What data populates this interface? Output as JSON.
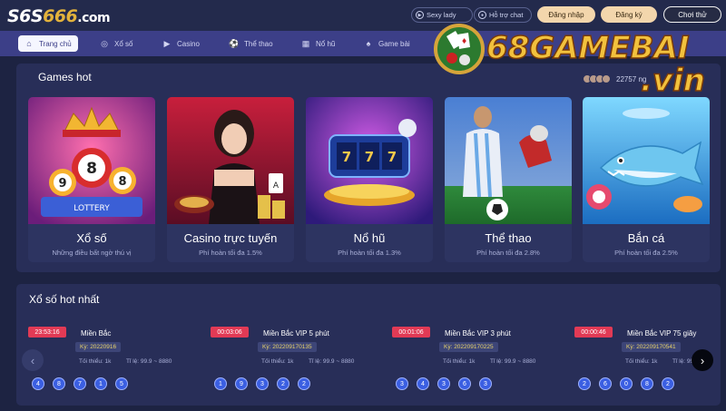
{
  "header": {
    "logo": {
      "left": "S6S",
      "accent": "666",
      "domain": ".com"
    },
    "sexy_lady": "Sexy lady",
    "live_chat": "Hỗ trợ chat",
    "login": "Đăng nhập",
    "register": "Đăng ký",
    "play_trial": "Chơi thử"
  },
  "nav": {
    "items": [
      {
        "label": "Trang chủ",
        "icon": "home-icon"
      },
      {
        "label": "Xổ số",
        "icon": "lottery-icon"
      },
      {
        "label": "Casino",
        "icon": "play-icon"
      },
      {
        "label": "Thể thao",
        "icon": "soccer-icon"
      },
      {
        "label": "Nổ hũ",
        "icon": "slot-icon"
      },
      {
        "label": "Game bài",
        "icon": "cards-icon"
      }
    ]
  },
  "games_hot": {
    "title": "Games hot",
    "online_count": "22757 ng",
    "cards": [
      {
        "title": "Xổ số",
        "sub": "Những điều bất ngờ thú vị",
        "art_label": "LOTTERY"
      },
      {
        "title": "Casino trực tuyến",
        "sub": "Phí hoàn tối đa 1.5%"
      },
      {
        "title": "Nổ hũ",
        "sub": "Phí hoàn tối đa 1.3%"
      },
      {
        "title": "Thể thao",
        "sub": "Phí hoàn tối đa 2.8%"
      },
      {
        "title": "Bắn cá",
        "sub": "Phí hoàn tối đa 2.5%"
      }
    ]
  },
  "lottery_hot": {
    "title": "Xổ số hot nhất",
    "items": [
      {
        "time": "23:53:16",
        "name": "Miền Bắc",
        "ky": "Kỳ: 20220916",
        "min": "Tối thiểu: 1k",
        "rate": "Tỉ lệ: 99.9 ~ 8880",
        "balls": [
          "4",
          "8",
          "7",
          "1",
          "5"
        ]
      },
      {
        "time": "00:03:06",
        "name": "Miền Bắc VIP 5 phút",
        "ky": "Kỳ: 202209170135",
        "min": "Tối thiểu: 1k",
        "rate": "Tỉ lệ: 99.9 ~ 8880",
        "balls": [
          "1",
          "9",
          "3",
          "2",
          "2"
        ]
      },
      {
        "time": "00:01:06",
        "name": "Miền Bắc VIP 3 phút",
        "ky": "Kỳ: 202209170225",
        "min": "Tối thiểu: 1k",
        "rate": "Tỉ lệ: 99.9 ~ 8880",
        "balls": [
          "3",
          "4",
          "3",
          "6",
          "3"
        ]
      },
      {
        "time": "00:00:46",
        "name": "Miền Bắc VIP 75 giây",
        "ky": "Kỳ: 202209170541",
        "min": "Tối thiểu: 1k",
        "rate": "Tỉ lệ: 99.9 ~",
        "balls": [
          "2",
          "6",
          "0",
          "8",
          "2"
        ]
      }
    ]
  },
  "watermark": {
    "text": "68GAMEBAI",
    "domain": ".vin"
  },
  "colors": {
    "nav_bg": "#3c3f88",
    "panel_bg": "#282e58",
    "gold": "#f3d6ac",
    "badge_red": "#e23a55",
    "ball_blue": "#3b5fe2"
  }
}
